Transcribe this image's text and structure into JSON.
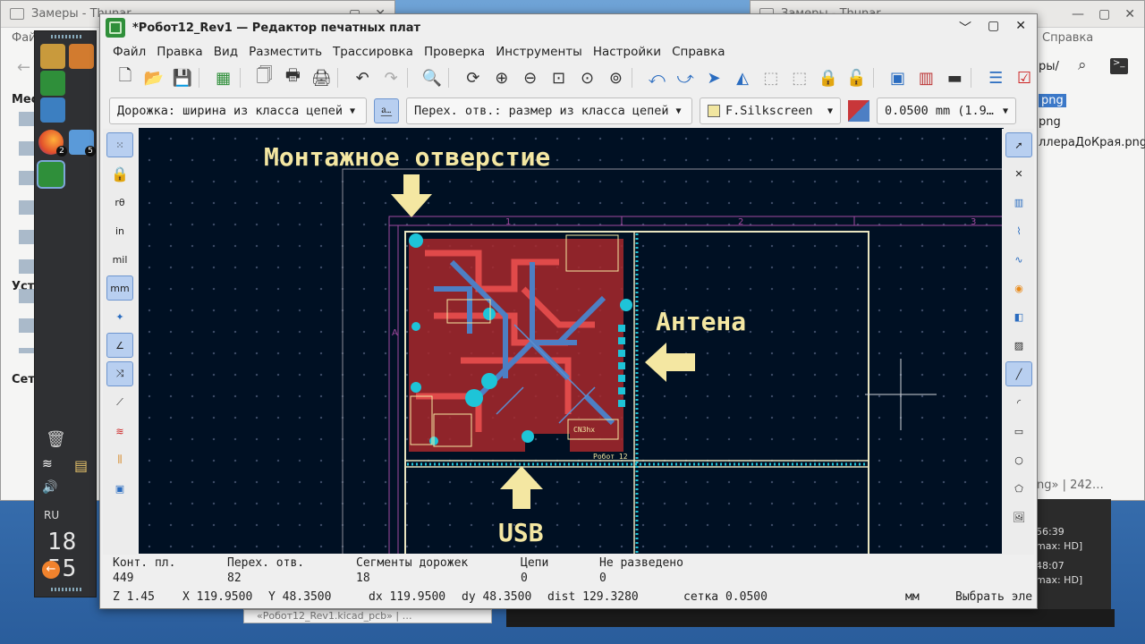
{
  "bg_left_window": {
    "title": "Замеры - Thunar",
    "menu_fragment": "Файл",
    "side_items": [
      "Мест",
      "Уст",
      "Сеть"
    ]
  },
  "bg_right_window": {
    "title": "Замеры - Thunar",
    "menu_right": "Справка",
    "path_fragment": "ры/",
    "files": [
      "png",
      "png",
      "ллераДоКрая.png"
    ],
    "status_fragment": "ng»  |  242…"
  },
  "bg_bottom_strip": {
    "text": "«Робот12_Rev1.kicad_pcb» | …"
  },
  "bg_video_list": [
    {
      "time": "56:39",
      "meta": "max: HD]"
    },
    {
      "time": "48:07",
      "meta": "max: HD]"
    }
  ],
  "dock": {
    "lang": "RU",
    "clock": "18 55",
    "badges": [
      "2",
      "5"
    ]
  },
  "window": {
    "title": "*Робот12_Rev1 — Редактор печатных плат",
    "controls": [
      "﹀",
      "▢",
      "✕"
    ],
    "menu": [
      "Файл",
      "Правка",
      "Вид",
      "Разместить",
      "Трассировка",
      "Проверка",
      "Инструменты",
      "Настройки",
      "Справка"
    ]
  },
  "toolbar2": {
    "track_width": "Дорожка: ширина из класса цепей",
    "via_size": "Перех. отв.: размер из класса цепей",
    "layer": "F.Silkscreen",
    "grid": "0.0500 mm (1.9…"
  },
  "left_tool_labels": {
    "in": "in",
    "mil": "mil",
    "mm": "mm"
  },
  "canvas": {
    "label_mount": "Монтажное отверстие",
    "label_antenna": "Антена",
    "label_usb": "USB",
    "frame_cols": [
      "1",
      "2",
      "3"
    ],
    "frame_row": "A",
    "silk_text": "Робот 12",
    "silk_text2": "CN3hx"
  },
  "status": {
    "headers": [
      "Конт. пл.",
      "Перех. отв.",
      "Сегменты дорожек",
      "Цепи",
      "Не разведено"
    ],
    "values": [
      "449",
      "82",
      "18",
      "0",
      "0"
    ],
    "zoom": "Z 1.45",
    "x": "X 119.9500",
    "y": "Y 48.3500",
    "dx": "dx 119.9500",
    "dy": "dy 48.3500",
    "dist": "dist 129.3280",
    "grid": "сетка 0.0500",
    "units": "мм",
    "mode": "Выбрать эле"
  },
  "colors": {
    "canvas_bg": "#001023",
    "copper_top": "#c8373a",
    "copper_bottom": "#4d7fc4",
    "pads": "#1ec4d8",
    "silk": "#f4e7a2"
  }
}
